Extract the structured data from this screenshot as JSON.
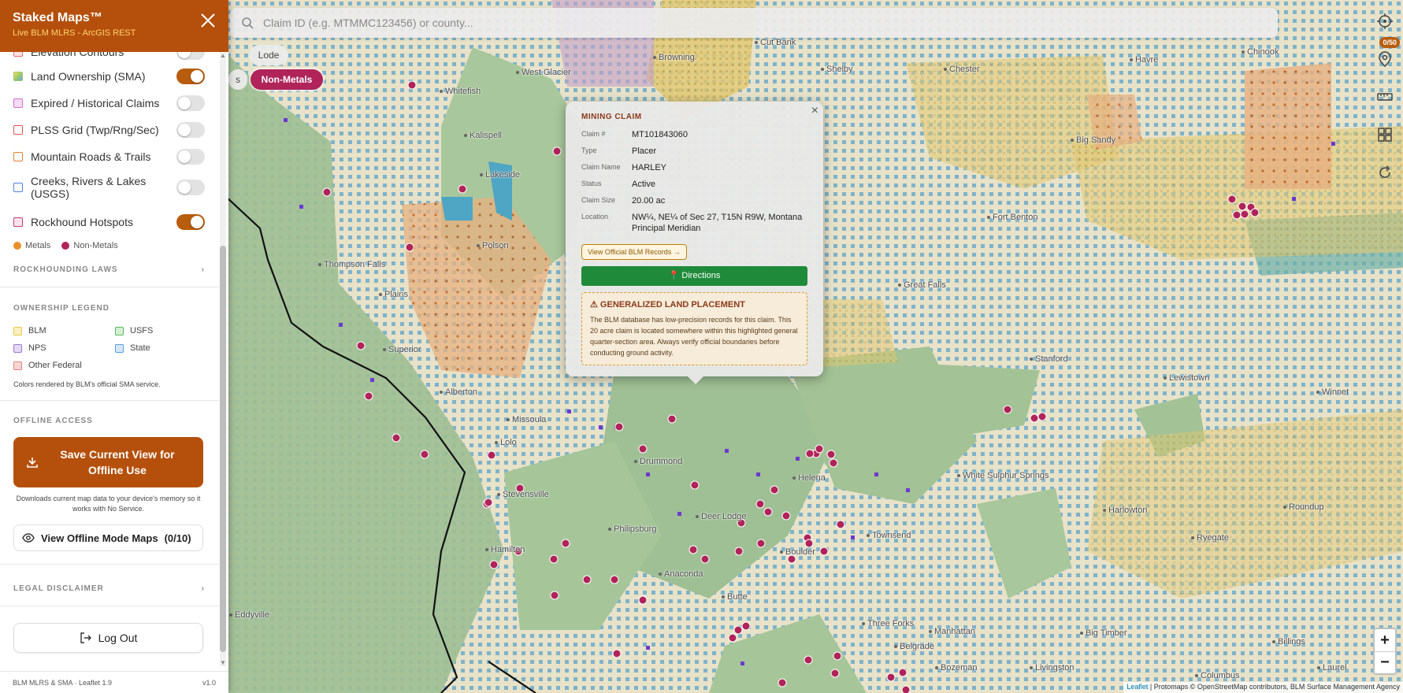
{
  "app": {
    "title": "Staked Maps™",
    "subtitle": "Live BLM MLRS - ArcGIS REST"
  },
  "search": {
    "placeholder": "Claim ID (e.g. MTMMC123456) or county..."
  },
  "chips": {
    "lode": "Lode",
    "hidden": "s",
    "nonmetals": "Non-Metals"
  },
  "tools": {
    "badge": "0/50"
  },
  "layers": [
    {
      "label": "Elevation Contours",
      "color": "#e06b6b",
      "on": false
    },
    {
      "label": "Land Ownership (SMA)",
      "color": "#9ccc65",
      "on": true
    },
    {
      "label": "Expired / Historical Claims",
      "color": "#d070d0",
      "on": false
    },
    {
      "label": "PLSS Grid (Twp/Rng/Sec)",
      "color": "#e05050",
      "on": false
    },
    {
      "label": "Mountain Roads & Trails",
      "color": "#e08030",
      "on": false
    },
    {
      "label": "Creeks, Rivers & Lakes (USGS)",
      "color": "#5080e0",
      "on": false
    },
    {
      "label": "Rockhound Hotspots",
      "color": "#c04070",
      "on": true
    }
  ],
  "mineral_legend": {
    "metals": "Metals",
    "nonmetals": "Non-Metals",
    "metals_color": "#e8902c",
    "nonmetals_color": "#b0245a"
  },
  "sections": {
    "rockhounding_laws": "ROCKHOUNDING LAWS",
    "ownership_legend": "OWNERSHIP LEGEND",
    "offline_access": "OFFLINE ACCESS",
    "legal_disclaimer": "LEGAL DISCLAIMER"
  },
  "ownership": [
    {
      "label": "BLM",
      "color": "#e6c84a"
    },
    {
      "label": "USFS",
      "color": "#5cb85c"
    },
    {
      "label": "NPS",
      "color": "#9b7bd0"
    },
    {
      "label": "State",
      "color": "#5b9be0"
    },
    {
      "label": "Other Federal",
      "color": "#e08080"
    }
  ],
  "ownership_note": "Colors rendered by BLM's official SMA service.",
  "offline": {
    "save_label": "Save Current View for Offline Use",
    "save_note": "Downloads current map data to your device's memory so it works with No Service.",
    "view_label": "View Offline Mode Maps",
    "view_count": "(0/10)"
  },
  "logout_label": "Log Out",
  "footer": {
    "left": "BLM MLRS & SMA · Leaflet 1.9",
    "right": "v1.0"
  },
  "popup": {
    "heading": "MINING CLAIM",
    "rows": [
      {
        "k": "Claim #",
        "v": "MT101843060"
      },
      {
        "k": "Type",
        "v": "Placer"
      },
      {
        "k": "Claim Name",
        "v": "HARLEY"
      },
      {
        "k": "Status",
        "v": "Active"
      },
      {
        "k": "Claim Size",
        "v": "20.00 ac"
      },
      {
        "k": "Location",
        "v": "NW¼, NE¼ of Sec 27, T15N R9W, Montana Principal Meridian"
      }
    ],
    "blm_button": "View Official BLM Records →",
    "directions_button": "📍 Directions",
    "warning_title": "GENERALIZED LAND PLACEMENT",
    "warning_text": "The BLM database has low-precision records for this claim. This 20 acre claim is located somewhere within this highlighted general quarter-section area. Always verify official boundaries before conducting ground activity."
  },
  "map": {
    "towns": [
      "Cut Bank",
      "Browning",
      "Shelby",
      "Chester",
      "Havre",
      "Chinook",
      "West Glacier",
      "Whitefish",
      "Kalispell",
      "Lakeside",
      "Polson",
      "Big Sandy",
      "Fort Benton",
      "Thompson Falls",
      "Plains",
      "Superior",
      "Great Falls",
      "Stanford",
      "Lewistown",
      "Winnet",
      "Alberton",
      "Missoula",
      "Lolo",
      "Drummond",
      "Helena",
      "White Sulphur Springs",
      "Stevensville",
      "Philipsburg",
      "Deer Lodge",
      "Townsend",
      "Hamilton",
      "Anaconda",
      "Boulder",
      "Harlowton",
      "Roundup",
      "Ryegate",
      "Butte",
      "Three Forks",
      "Manhattan",
      "Belgrade",
      "Big Timber",
      "Billings",
      "Bozeman",
      "Livingston",
      "Columbus",
      "Laurel",
      "Eddyville"
    ],
    "zoom_in": "+",
    "zoom_out": "−",
    "attribution_leaflet": "Leaflet",
    "attribution_rest": " | Protomaps © OpenStreetMap contributors, BLM Surface Management Agency"
  }
}
